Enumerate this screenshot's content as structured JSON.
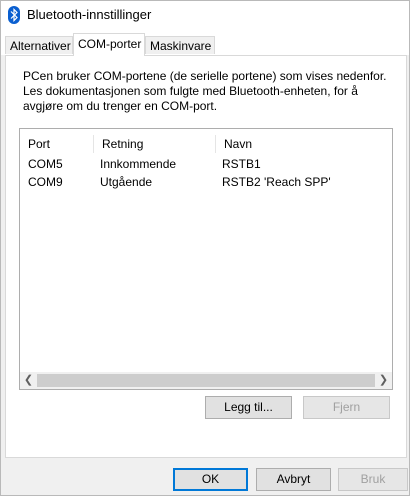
{
  "window": {
    "title": "Bluetooth-innstillinger",
    "icon": "bluetooth-icon"
  },
  "tabs": [
    {
      "label": "Alternativer",
      "active": false
    },
    {
      "label": "COM-porter",
      "active": true
    },
    {
      "label": "Maskinvare",
      "active": false
    }
  ],
  "description": {
    "line1": "PCen bruker COM-portene (de serielle portene) som vises nedenfor.",
    "line2": "Les dokumentasjonen som fulgte med Bluetooth-enheten, for å",
    "line3": "avgjøre om du trenger en COM-port."
  },
  "ports_list": {
    "columns": [
      "Port",
      "Retning",
      "Navn"
    ],
    "rows": [
      {
        "port": "COM5",
        "direction": "Innkommende",
        "name": "RSTB1"
      },
      {
        "port": "COM9",
        "direction": "Utgående",
        "name": "RSTB2 'Reach SPP'"
      }
    ]
  },
  "scrollbar": {
    "left_icon": "chevron-left-icon",
    "right_icon": "chevron-right-icon"
  },
  "panel_buttons": {
    "add": "Legg til...",
    "remove": "Fjern"
  },
  "dialog_buttons": {
    "ok": "OK",
    "cancel": "Avbryt",
    "apply": "Bruk"
  },
  "colors": {
    "accent": "#0078d7",
    "bluetooth_icon": "#0a5fd0"
  }
}
